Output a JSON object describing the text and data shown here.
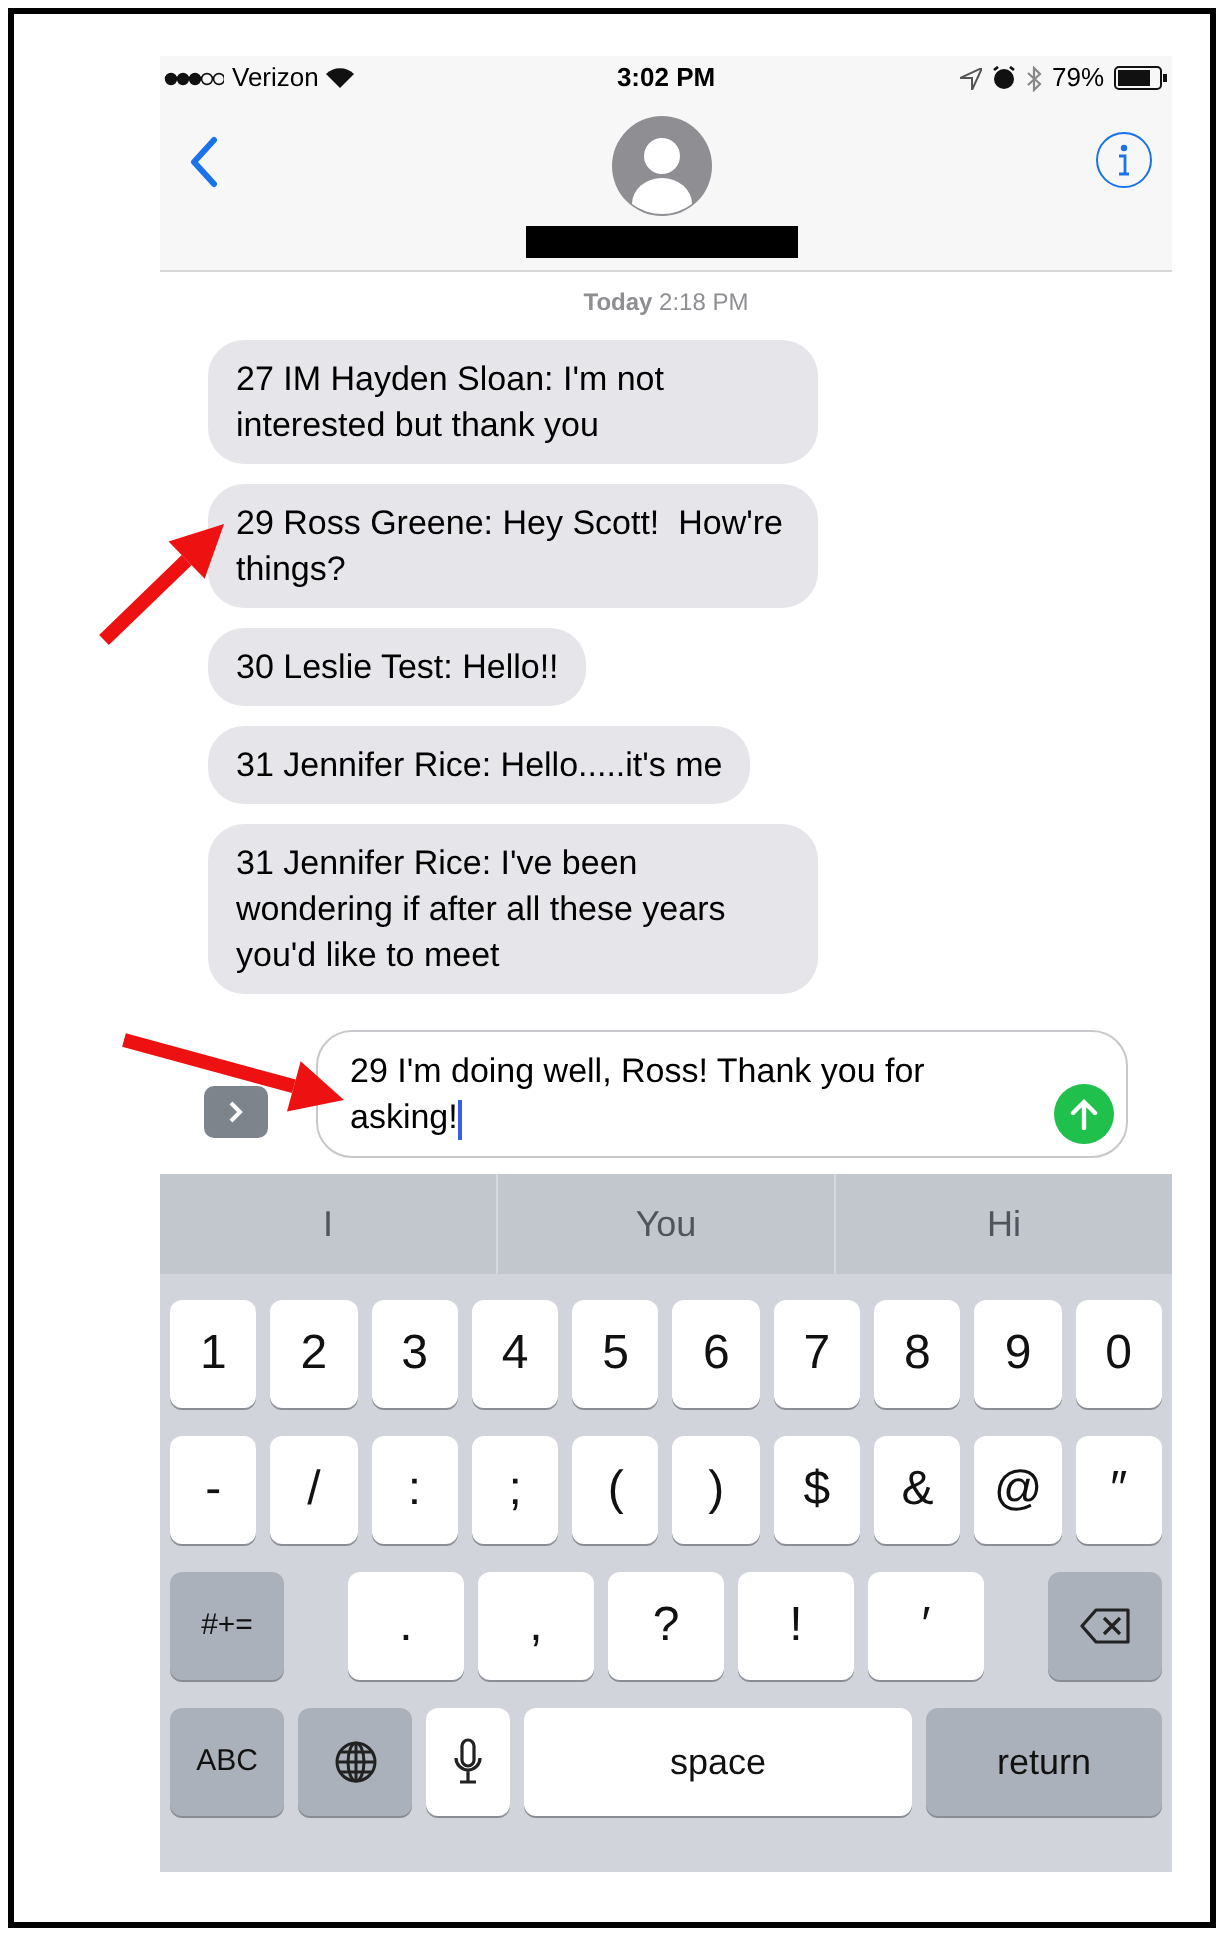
{
  "status_bar": {
    "carrier": "Verizon",
    "time": "3:02 PM",
    "battery": "79%"
  },
  "timestamp": {
    "day": "Today",
    "time": "2:18 PM"
  },
  "messages": [
    {
      "text": "27 IM Hayden Sloan: I'm not interested but thank you"
    },
    {
      "text": "29 Ross Greene: Hey Scott!  How're things?"
    },
    {
      "text": "30 Leslie Test: Hello!!"
    },
    {
      "text": "31 Jennifer Rice: Hello.....it's me"
    },
    {
      "text": "31 Jennifer Rice: I've been wondering if after all these years you'd like to meet"
    }
  ],
  "composer": {
    "value": "29 I'm doing well, Ross! Thank you for asking!"
  },
  "suggestions": [
    "I",
    "You",
    "Hi"
  ],
  "keyboard": [
    [
      {
        "kind": "char",
        "label": "1"
      },
      {
        "kind": "char",
        "label": "2"
      },
      {
        "kind": "char",
        "label": "3"
      },
      {
        "kind": "char",
        "label": "4"
      },
      {
        "kind": "char",
        "label": "5"
      },
      {
        "kind": "char",
        "label": "6"
      },
      {
        "kind": "char",
        "label": "7"
      },
      {
        "kind": "char",
        "label": "8"
      },
      {
        "kind": "char",
        "label": "9"
      },
      {
        "kind": "char",
        "label": "0"
      }
    ],
    [
      {
        "kind": "char",
        "label": "-"
      },
      {
        "kind": "char",
        "label": "/"
      },
      {
        "kind": "char",
        "label": ":"
      },
      {
        "kind": "char",
        "label": ";"
      },
      {
        "kind": "char",
        "label": "("
      },
      {
        "kind": "char",
        "label": ")"
      },
      {
        "kind": "char",
        "label": "$"
      },
      {
        "kind": "char",
        "label": "&"
      },
      {
        "kind": "char",
        "label": "@"
      },
      {
        "kind": "char",
        "label": "″"
      }
    ],
    [
      {
        "kind": "function",
        "label": "#+="
      },
      {
        "kind": "punct",
        "label": "."
      },
      {
        "kind": "punct",
        "label": ","
      },
      {
        "kind": "punct",
        "label": "?"
      },
      {
        "kind": "punct",
        "label": "!"
      },
      {
        "kind": "punct",
        "label": "′"
      },
      {
        "kind": "backspace"
      }
    ],
    [
      {
        "kind": "function",
        "label": "ABC"
      },
      {
        "kind": "globe"
      },
      {
        "kind": "mic"
      },
      {
        "kind": "space",
        "label": "space"
      },
      {
        "kind": "return",
        "label": "return"
      }
    ]
  ]
}
